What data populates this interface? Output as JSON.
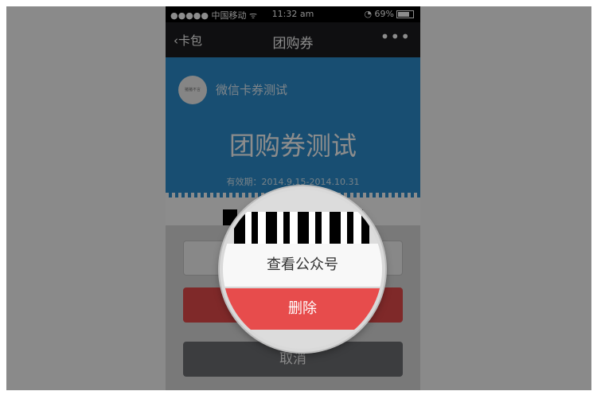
{
  "status": {
    "carrier": "●●●●● 中国移动 ᯤ",
    "time": "11:32 am",
    "battery": "◔ 69%"
  },
  "nav": {
    "back": "卡包",
    "title": "团购券",
    "more": "•••"
  },
  "card": {
    "logo_text": "猪猪不言",
    "merchant": "微信卡券测试",
    "title": "团购券测试",
    "validity": "有效期：2014.9.15-2014.10.31"
  },
  "sheet": {
    "view_public": "查看公众号",
    "delete": "删除",
    "cancel": "取消"
  },
  "colors": {
    "card_blue": "#2c8fcf",
    "delete_red": "#e74c4c",
    "dim_gray": "#8a8a8a"
  }
}
